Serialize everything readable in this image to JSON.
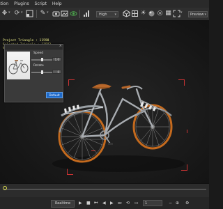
{
  "menubar": {
    "items": [
      "ation",
      "Plugins",
      "Script",
      "Help"
    ]
  },
  "toolbar": {
    "quality": "High",
    "view_mode": "Preview",
    "active_accent": "#4ca84c"
  },
  "stats": {
    "lines": [
      "Project Triangle : 11598",
      "Selected Triangle : 11592",
      "Video Memory : 0.4GB"
    ]
  },
  "preview_panel": {
    "speed_label": "Speed",
    "speed_value": "1.0",
    "rotate_label": "Rotate",
    "rotate_value": "0",
    "button_label": "Default"
  },
  "playback": {
    "realtime_label": "Realtime",
    "frame_value": "1"
  },
  "colors": {
    "selection_corners": "#cc3333",
    "stats_text": "#f2f28a",
    "button_blue": "#1d69c9"
  }
}
